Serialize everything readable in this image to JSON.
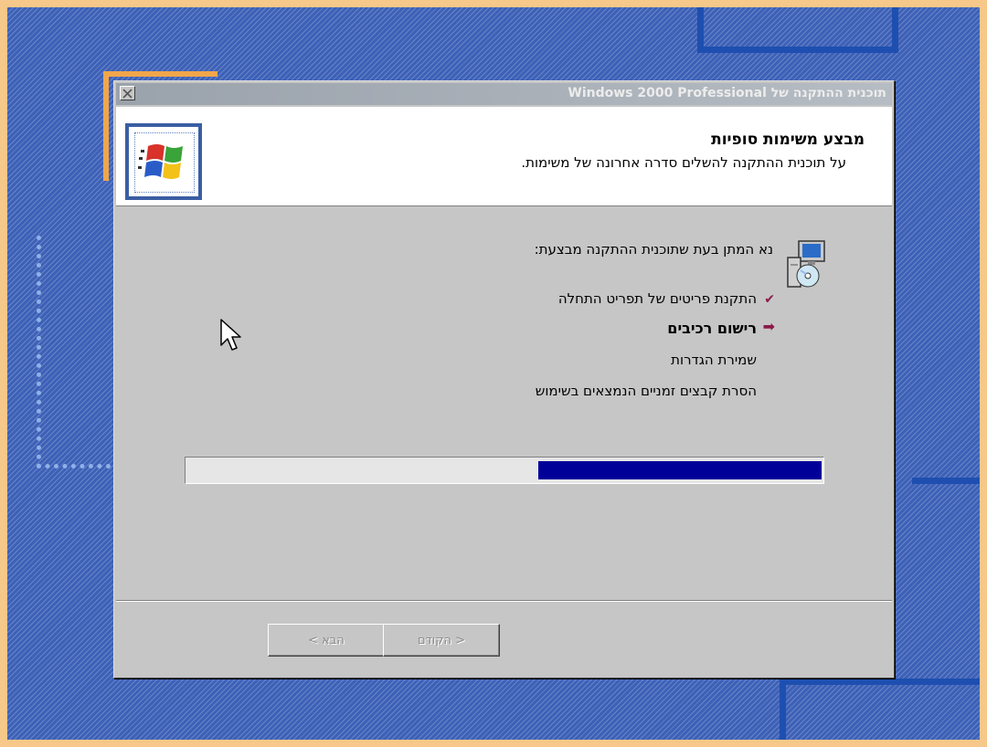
{
  "window": {
    "title": "תוכנית ההתקנה של Windows 2000 Professional",
    "close_icon": "close-icon"
  },
  "header": {
    "title": "מבצע משימות סופיות",
    "subtitle": "על תוכנית ההתקנה להשלים סדרה אחרונה של משימות.",
    "logo_icon": "windows-logo-icon"
  },
  "content": {
    "wait_message": "נא המתן בעת שתוכנית ההתקנה מבצעת:",
    "install_icon": "computer-cd-install-icon",
    "tasks": [
      {
        "label": "התקנת פריטים של תפריט התחלה",
        "status": "done",
        "icon": "checkmark-icon"
      },
      {
        "label": "רישום רכיבים",
        "status": "current",
        "icon": "arrow-icon"
      },
      {
        "label": "שמירת הגדרות",
        "status": "pending"
      },
      {
        "label": "הסרת קבצים זמניים הנמצאים בשימוש",
        "status": "pending"
      }
    ],
    "progress": {
      "fraction": 0.45,
      "color": "#000099"
    }
  },
  "buttons": {
    "back_label": "< הקודם",
    "next_label": "הבא >"
  },
  "colors": {
    "desktop": "#3d61b7",
    "dialog": "#c6c6c6",
    "accent_marker": "#8b1a4a"
  }
}
